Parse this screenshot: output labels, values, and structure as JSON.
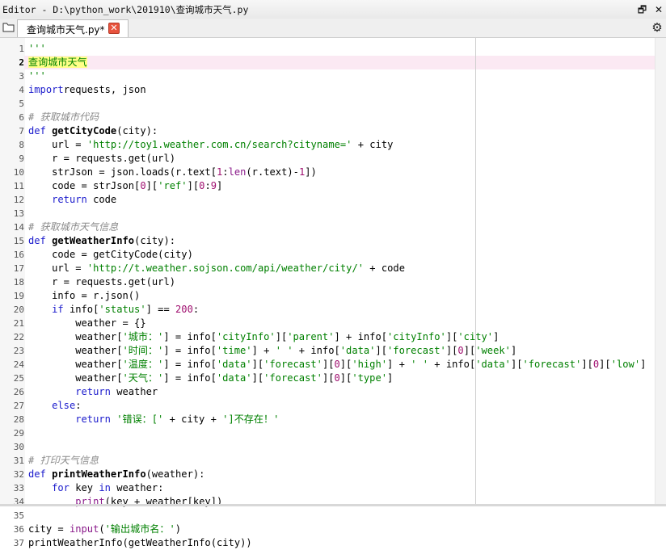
{
  "window": {
    "title": "Editor - D:\\python_work\\201910\\查询城市天气.py",
    "controls": [
      "🗗",
      "✕"
    ]
  },
  "tabbar": {
    "tab_label": "查询城市天气.py*",
    "close_glyph": "✕",
    "settings_glyph": "⚙"
  },
  "editor": {
    "current_line": 2,
    "lines": [
      {
        "n": "1",
        "tokens": [
          [
            "str",
            "'''"
          ]
        ]
      },
      {
        "n": "2",
        "tokens": [
          [
            "hl",
            "查询城市天气"
          ]
        ]
      },
      {
        "n": "3",
        "tokens": [
          [
            "str",
            "'''"
          ]
        ]
      },
      {
        "n": "4",
        "tokens": [
          [
            "kw",
            "import"
          ],
          [
            "",
            "requests, json"
          ]
        ]
      },
      {
        "n": "5",
        "tokens": []
      },
      {
        "n": "6",
        "tokens": [
          [
            "cm",
            "# 获取城市代码"
          ]
        ]
      },
      {
        "n": "7",
        "tokens": [
          [
            "kw",
            "def"
          ],
          [
            "",
            ""
          ],
          [
            "fn",
            "getCityCode"
          ],
          [
            "",
            "(city):"
          ]
        ]
      },
      {
        "n": "8",
        "tokens": [
          [
            "",
            "    url = "
          ],
          [
            "str",
            "'http://toy1.weather.com.cn/search?cityname='"
          ],
          [
            "",
            " + city"
          ]
        ]
      },
      {
        "n": "9",
        "tokens": [
          [
            "",
            "    r = requests.get(url)"
          ]
        ]
      },
      {
        "n": "10",
        "tokens": [
          [
            "",
            "    strJson = json.loads(r.text["
          ],
          [
            "nm",
            "1"
          ],
          [
            "",
            ":"
          ],
          [
            "bi",
            "len"
          ],
          [
            "",
            "(r.text)-"
          ],
          [
            "nm",
            "1"
          ],
          [
            "",
            "])"
          ]
        ]
      },
      {
        "n": "11",
        "tokens": [
          [
            "",
            "    code = strJson["
          ],
          [
            "nm",
            "0"
          ],
          [
            "",
            "]["
          ],
          [
            "str",
            "'ref'"
          ],
          [
            "",
            "]["
          ],
          [
            "nm",
            "0"
          ],
          [
            "",
            ":"
          ],
          [
            "nm",
            "9"
          ],
          [
            "",
            "]"
          ]
        ]
      },
      {
        "n": "12",
        "tokens": [
          [
            "",
            "    "
          ],
          [
            "kw",
            "return"
          ],
          [
            "",
            " code"
          ]
        ]
      },
      {
        "n": "13",
        "tokens": []
      },
      {
        "n": "14",
        "tokens": [
          [
            "cm",
            "# 获取城市天气信息"
          ]
        ]
      },
      {
        "n": "15",
        "tokens": [
          [
            "kw",
            "def"
          ],
          [
            "",
            ""
          ],
          [
            "fn",
            "getWeatherInfo"
          ],
          [
            "",
            "(city):"
          ]
        ]
      },
      {
        "n": "16",
        "tokens": [
          [
            "",
            "    code = getCityCode(city)"
          ]
        ]
      },
      {
        "n": "17",
        "tokens": [
          [
            "",
            "    url = "
          ],
          [
            "str",
            "'http://t.weather.sojson.com/api/weather/city/'"
          ],
          [
            "",
            " + code"
          ]
        ]
      },
      {
        "n": "18",
        "tokens": [
          [
            "",
            "    r = requests.get(url)"
          ]
        ]
      },
      {
        "n": "19",
        "tokens": [
          [
            "",
            "    info = r.json()"
          ]
        ]
      },
      {
        "n": "20",
        "tokens": [
          [
            "",
            "    "
          ],
          [
            "kw",
            "if"
          ],
          [
            "",
            " info["
          ],
          [
            "str",
            "'status'"
          ],
          [
            "",
            "] == "
          ],
          [
            "nm",
            "200"
          ],
          [
            "",
            ":"
          ]
        ]
      },
      {
        "n": "21",
        "tokens": [
          [
            "",
            "        weather = {}"
          ]
        ]
      },
      {
        "n": "22",
        "tokens": [
          [
            "",
            "        weather["
          ],
          [
            "str",
            "'城市：'"
          ],
          [
            "",
            "] = info["
          ],
          [
            "str",
            "'cityInfo'"
          ],
          [
            "",
            "]["
          ],
          [
            "str",
            "'parent'"
          ],
          [
            "",
            "] + info["
          ],
          [
            "str",
            "'cityInfo'"
          ],
          [
            "",
            "]["
          ],
          [
            "str",
            "'city'"
          ],
          [
            "",
            "]"
          ]
        ]
      },
      {
        "n": "23",
        "tokens": [
          [
            "",
            "        weather["
          ],
          [
            "str",
            "'时间：'"
          ],
          [
            "",
            "] = info["
          ],
          [
            "str",
            "'time'"
          ],
          [
            "",
            "] + "
          ],
          [
            "str",
            "' '"
          ],
          [
            "",
            " + info["
          ],
          [
            "str",
            "'data'"
          ],
          [
            "",
            "]["
          ],
          [
            "str",
            "'forecast'"
          ],
          [
            "",
            "]["
          ],
          [
            "nm",
            "0"
          ],
          [
            "",
            "]["
          ],
          [
            "str",
            "'week'"
          ],
          [
            "",
            "]"
          ]
        ]
      },
      {
        "n": "24",
        "tokens": [
          [
            "",
            "        weather["
          ],
          [
            "str",
            "'温度：'"
          ],
          [
            "",
            "] = info["
          ],
          [
            "str",
            "'data'"
          ],
          [
            "",
            "]["
          ],
          [
            "str",
            "'forecast'"
          ],
          [
            "",
            "]["
          ],
          [
            "nm",
            "0"
          ],
          [
            "",
            "]["
          ],
          [
            "str",
            "'high'"
          ],
          [
            "",
            "] + "
          ],
          [
            "str",
            "' '"
          ],
          [
            "",
            " + info["
          ],
          [
            "str",
            "'data'"
          ],
          [
            "",
            "]["
          ],
          [
            "str",
            "'forecast'"
          ],
          [
            "",
            "]["
          ],
          [
            "nm",
            "0"
          ],
          [
            "",
            "]["
          ],
          [
            "str",
            "'low'"
          ],
          [
            "",
            "]"
          ]
        ]
      },
      {
        "n": "25",
        "tokens": [
          [
            "",
            "        weather["
          ],
          [
            "str",
            "'天气：'"
          ],
          [
            "",
            "] = info["
          ],
          [
            "str",
            "'data'"
          ],
          [
            "",
            "]["
          ],
          [
            "str",
            "'forecast'"
          ],
          [
            "",
            "]["
          ],
          [
            "nm",
            "0"
          ],
          [
            "",
            "]["
          ],
          [
            "str",
            "'type'"
          ],
          [
            "",
            "]"
          ]
        ]
      },
      {
        "n": "26",
        "tokens": [
          [
            "",
            "        "
          ],
          [
            "kw",
            "return"
          ],
          [
            "",
            " weather"
          ]
        ]
      },
      {
        "n": "27",
        "tokens": [
          [
            "",
            "    "
          ],
          [
            "kw",
            "else"
          ],
          [
            "",
            ":"
          ]
        ]
      },
      {
        "n": "28",
        "tokens": [
          [
            "",
            "        "
          ],
          [
            "kw",
            "return"
          ],
          [
            "",
            ""
          ],
          [
            "str",
            "'错误：['"
          ],
          [
            "",
            " + city + "
          ],
          [
            "str",
            "']不存在！'"
          ]
        ]
      },
      {
        "n": "29",
        "tokens": []
      },
      {
        "n": "30",
        "tokens": []
      },
      {
        "n": "31",
        "tokens": [
          [
            "cm",
            "# 打印天气信息"
          ]
        ]
      },
      {
        "n": "32",
        "tokens": [
          [
            "kw",
            "def"
          ],
          [
            "",
            ""
          ],
          [
            "fn",
            "printWeatherInfo"
          ],
          [
            "",
            "(weather):"
          ]
        ]
      },
      {
        "n": "33",
        "tokens": [
          [
            "",
            "    "
          ],
          [
            "kw",
            "for"
          ],
          [
            "",
            " key "
          ],
          [
            "kw",
            "in"
          ],
          [
            "",
            " weather:"
          ]
        ]
      },
      {
        "n": "34",
        "tokens": [
          [
            "",
            "        "
          ],
          [
            "bi",
            "print"
          ],
          [
            "",
            "(key + weather[key])"
          ]
        ]
      },
      {
        "n": "35",
        "tokens": []
      },
      {
        "n": "36",
        "tokens": [
          [
            "",
            "city = "
          ],
          [
            "bi",
            "input"
          ],
          [
            "",
            "("
          ],
          [
            "str",
            "'输出城市名：'"
          ],
          [
            "",
            ")"
          ]
        ]
      },
      {
        "n": "37",
        "tokens": [
          [
            "",
            "printWeatherInfo(getWeatherInfo(city))"
          ]
        ]
      }
    ]
  }
}
